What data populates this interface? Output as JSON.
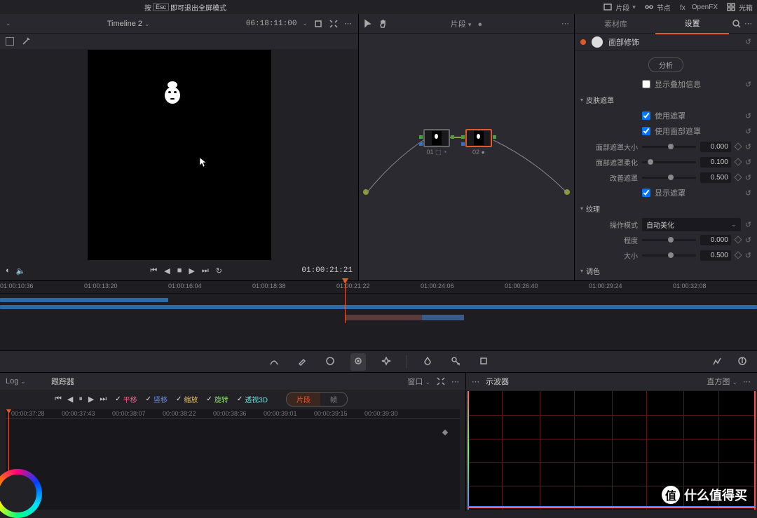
{
  "topbar": {
    "esc_prefix": "按",
    "esc_key": "Esc",
    "esc_suffix": "即可退出全屏模式",
    "clips_btn": "片段",
    "nodes_btn": "节点",
    "openfx_btn": "OpenFX",
    "lightbox_btn": "光箱"
  },
  "viewer": {
    "timeline_name": "Timeline 2",
    "src_timecode": "06:18:11:00",
    "rec_timecode": "01:00:21:21"
  },
  "node_editor": {
    "title": "片段",
    "node1_label": "01",
    "node2_label": "02"
  },
  "inspector": {
    "tab_library": "素材库",
    "tab_settings": "设置",
    "header_title": "面部修饰",
    "analyze_btn": "分析",
    "show_overlay": "显示叠加信息",
    "section_skin": "皮肤遮罩",
    "use_mask": "使用遮罩",
    "use_face_mask": "使用面部遮罩",
    "face_mask_size_label": "面部遮罩大小",
    "face_mask_size_value": "0.000",
    "face_mask_soft_label": "面部遮罩柔化",
    "face_mask_soft_value": "0.100",
    "refine_mask_label": "改善遮罩",
    "refine_mask_value": "0.500",
    "show_mask": "显示遮罩",
    "section_texture": "纹理",
    "operation_mode_label": "操作模式",
    "operation_mode_value": "自动美化",
    "level_label": "程度",
    "level_value": "0.000",
    "size_label": "大小",
    "size_value": "0.500",
    "section_tone": "调色"
  },
  "timeline": {
    "ticks": [
      "01:00:10:36",
      "01:00:13:20",
      "01:00:16:04",
      "01:00:18:38",
      "01:00:21:22",
      "01:00:24:06",
      "01:00:26:40",
      "01:00:29:24",
      "01:00:32:08"
    ]
  },
  "tracker": {
    "mode_label": "Log",
    "title": "跟踪器",
    "window_label": "窗口",
    "pan": "平移",
    "tilt": "竖移",
    "zoom": "缩放",
    "rotate": "旋转",
    "perspective": "透视3D",
    "pill_clip": "片段",
    "pill_frame": "帧",
    "ticks": [
      "00:00:37:28",
      "00:00:37:43",
      "00:00:38:07",
      "00:00:38:22",
      "00:00:38:36",
      "00:00:39:01",
      "00:00:39:15",
      "00:00:39:30"
    ]
  },
  "scopes": {
    "title": "示波器",
    "mode": "直方图"
  },
  "watermark": {
    "badge": "值",
    "text": "什么值得买"
  }
}
